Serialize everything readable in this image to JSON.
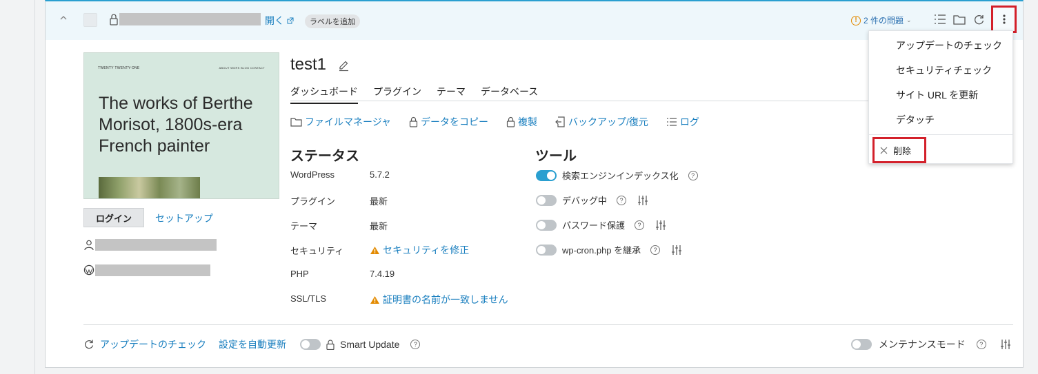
{
  "header": {
    "open_link": "開く",
    "add_label": "ラベルを追加",
    "issues": "2 件の問題",
    "issues_icon": "warning-circle-icon"
  },
  "thumbnail": {
    "site_header": "TWENTY TWENTY-ONE",
    "nav": "ABOUT  WORK  BLOG  CONTACT",
    "headline": "The works of Berthe Morisot, 1800s-era French painter"
  },
  "left": {
    "login_button": "ログイン",
    "setup_link": "セットアップ"
  },
  "site": {
    "title": "test1"
  },
  "tabs": [
    "ダッシュボード",
    "プラグイン",
    "テーマ",
    "データベース"
  ],
  "actions": [
    {
      "label": "ファイルマネージャ",
      "icon": "folder-icon"
    },
    {
      "label": "データをコピー",
      "icon": "lock-icon"
    },
    {
      "label": "複製",
      "icon": "lock-icon"
    },
    {
      "label": "バックアップ/復元",
      "icon": "backup-icon"
    },
    {
      "label": "ログ",
      "icon": "list-icon"
    }
  ],
  "status": {
    "title": "ステータス",
    "rows": [
      {
        "label": "WordPress",
        "value": "5.7.2"
      },
      {
        "label": "プラグイン",
        "value": "最新"
      },
      {
        "label": "テーマ",
        "value": "最新"
      },
      {
        "label": "セキュリティ",
        "value": "セキュリティを修正"
      },
      {
        "label": "PHP",
        "value": "7.4.19"
      },
      {
        "label": "SSL/TLS",
        "value": "証明書の名前が一致しません"
      }
    ]
  },
  "tools": {
    "title": "ツール",
    "rows": [
      {
        "label": "検索エンジンインデックス化",
        "on": true
      },
      {
        "label": "デバッグ中",
        "on": false
      },
      {
        "label": "パスワード保護",
        "on": false
      },
      {
        "label": "wp-cron.php を継承",
        "on": false
      }
    ]
  },
  "footer": {
    "check_updates": "アップデートのチェック",
    "auto_update": "設定を自動更新",
    "smart_update": "Smart Update",
    "maintenance": "メンテナンスモード"
  },
  "menu": {
    "items": [
      "アップデートのチェック",
      "セキュリティチェック",
      "サイト URL を更新",
      "デタッチ"
    ],
    "delete": "削除"
  },
  "colors": {
    "accent": "#2a9fd0",
    "link": "#1a7fbf",
    "warning": "#e38a00",
    "highlight": "#d3202a"
  }
}
